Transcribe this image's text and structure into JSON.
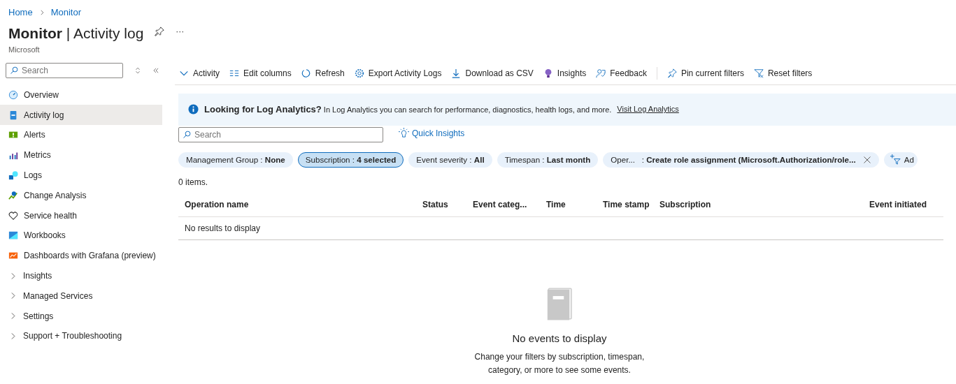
{
  "breadcrumb": [
    "Home",
    "Monitor"
  ],
  "title": "**Monitor** | Activity log",
  "more_button": "···",
  "subtitle": "Microsoft",
  "sidebar": {
    "search": {
      "placeholder": "Search"
    },
    "items": [
      {
        "label": "Overview",
        "kind": "link",
        "selected": false
      },
      {
        "label": "Activity log",
        "kind": "link",
        "selected": true
      },
      {
        "label": "Alerts",
        "kind": "link",
        "selected": false
      },
      {
        "label": "Metrics",
        "kind": "link",
        "selected": false
      },
      {
        "label": "Logs",
        "kind": "link",
        "selected": false
      },
      {
        "label": "Change Analysis",
        "kind": "link",
        "selected": false
      },
      {
        "label": "Service health",
        "kind": "link",
        "selected": false
      },
      {
        "label": "Workbooks",
        "kind": "link",
        "selected": false
      },
      {
        "label": "Dashboards with Grafana (preview)",
        "kind": "link",
        "selected": false
      },
      {
        "label": "Insights",
        "kind": "group",
        "selected": false,
        "expanded": false
      },
      {
        "label": "Managed Services",
        "kind": "group",
        "selected": false,
        "expanded": false
      },
      {
        "label": "Settings",
        "kind": "group",
        "selected": false,
        "expanded": false
      },
      {
        "label": "Support + Troubleshooting",
        "kind": "group",
        "selected": false,
        "expanded": false
      }
    ]
  },
  "toolbar": [
    "Activity",
    "Edit columns",
    "Refresh",
    "Export Activity Logs",
    "Download as CSV",
    "Insights",
    "Feedback",
    "Pin current filters",
    "Reset filters"
  ],
  "banner": {
    "title": "Looking for Log Analytics?",
    "text": "In Log Analytics you can search for performance, diagnostics, health logs, and more.",
    "link": "Visit Log Analytics"
  },
  "search": {
    "placeholder": "Search"
  },
  "quick_insights": "Quick Insights",
  "filters": [
    {
      "label": "Management Group : ",
      "value": "None",
      "selected": false,
      "removable": false
    },
    {
      "label": "Subscription : ",
      "value": "4 selected",
      "selected": true,
      "removable": false
    },
    {
      "label": "Event severity : ",
      "value": "All",
      "selected": false,
      "removable": false
    },
    {
      "label": "Timespan : ",
      "value": "Last month",
      "selected": false,
      "removable": false
    },
    {
      "label": "Oper...   : ",
      "value": "Create role assignment (Microsoft.Authorization/role...",
      "selected": false,
      "removable": true
    }
  ],
  "add_filter": "Ad",
  "items_count": "0 items.",
  "table": {
    "columns": [
      "Operation name",
      "Status",
      "Event categ...",
      "Time",
      "Time stamp",
      "Subscription",
      "Event initiated"
    ],
    "empty_text": "No results to display"
  },
  "empty_state": {
    "title": "No events to display",
    "text": "Change your filters by subscription, timespan, category, or more to see some events."
  }
}
